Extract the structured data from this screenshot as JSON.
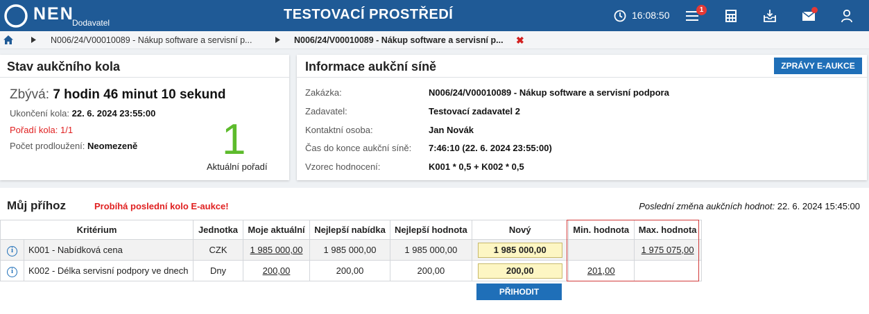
{
  "header": {
    "logo_text": "NEN",
    "logo_sub": "Dodavatel",
    "env_title": "TESTOVACÍ PROSTŘEDÍ",
    "time": "16:08:50",
    "notification_count": "1",
    "icons": [
      "clock-icon",
      "menu-icon",
      "calculator-icon",
      "inbox-download-icon",
      "mail-icon",
      "user-icon"
    ],
    "colors": {
      "bar": "#1f5a96",
      "badge": "#e53935"
    }
  },
  "breadcrumb": {
    "items": [
      "N006/24/V00010089 - Nákup software a servisní p...",
      "N006/24/V00010089 - Nákup software a servisní p..."
    ],
    "close": "✖"
  },
  "round_status": {
    "title": "Stav aukčního kola",
    "remaining_label": "Zbývá:",
    "remaining_value": "7 hodin 46 minut 10 sekund",
    "end_label": "Ukončení kola:",
    "end_value": "22. 6. 2024 23:55:00",
    "order_label": "Pořadí kola:",
    "order_value": "1/1",
    "ext_label": "Počet prodloužení:",
    "ext_value": "Neomezeně",
    "rank": "1",
    "rank_label": "Aktuální pořadí"
  },
  "hall_info": {
    "title": "Informace aukční síně",
    "button": "ZPRÁVY E-AUKCE",
    "rows": [
      {
        "label": "Zakázka:",
        "value": "N006/24/V00010089 - Nákup software a servisní podpora"
      },
      {
        "label": "Zadavatel:",
        "value": "Testovací zadavatel 2"
      },
      {
        "label": "Kontaktní osoba:",
        "value": "Jan Novák"
      },
      {
        "label": "Čas do konce aukční síně:",
        "value": "7:46:10 (22. 6. 2024 23:55:00)"
      },
      {
        "label": "Vzorec hodnocení:",
        "value": "K001 * 0,5 + K002 * 0,5"
      }
    ]
  },
  "bid": {
    "title": "Můj příhoz",
    "warning": "Probíhá poslední kolo E-aukce!",
    "last_change_label": "Poslední změna aukčních hodnot:",
    "last_change_value": "22. 6. 2024 15:45:00",
    "columns": [
      "Kritérium",
      "Jednotka",
      "Moje aktuální",
      "Nejlepší nabídka",
      "Nejlepší hodnota",
      "Nový",
      "Min. hodnota",
      "Max. hodnota"
    ],
    "rows": [
      {
        "criterion": "K001 - Nabídková cena",
        "unit": "CZK",
        "mine": "1 985 000,00",
        "best_offer": "1 985 000,00",
        "best_value": "1 985 000,00",
        "new": "1 985 000,00",
        "min": "",
        "max": "1 975 075,00"
      },
      {
        "criterion": "K002 - Délka servisní podpory ve dnech",
        "unit": "Dny",
        "mine": "200,00",
        "best_offer": "200,00",
        "best_value": "200,00",
        "new": "200,00",
        "min": "201,00",
        "max": ""
      }
    ],
    "submit": "PŘIHODIT"
  }
}
